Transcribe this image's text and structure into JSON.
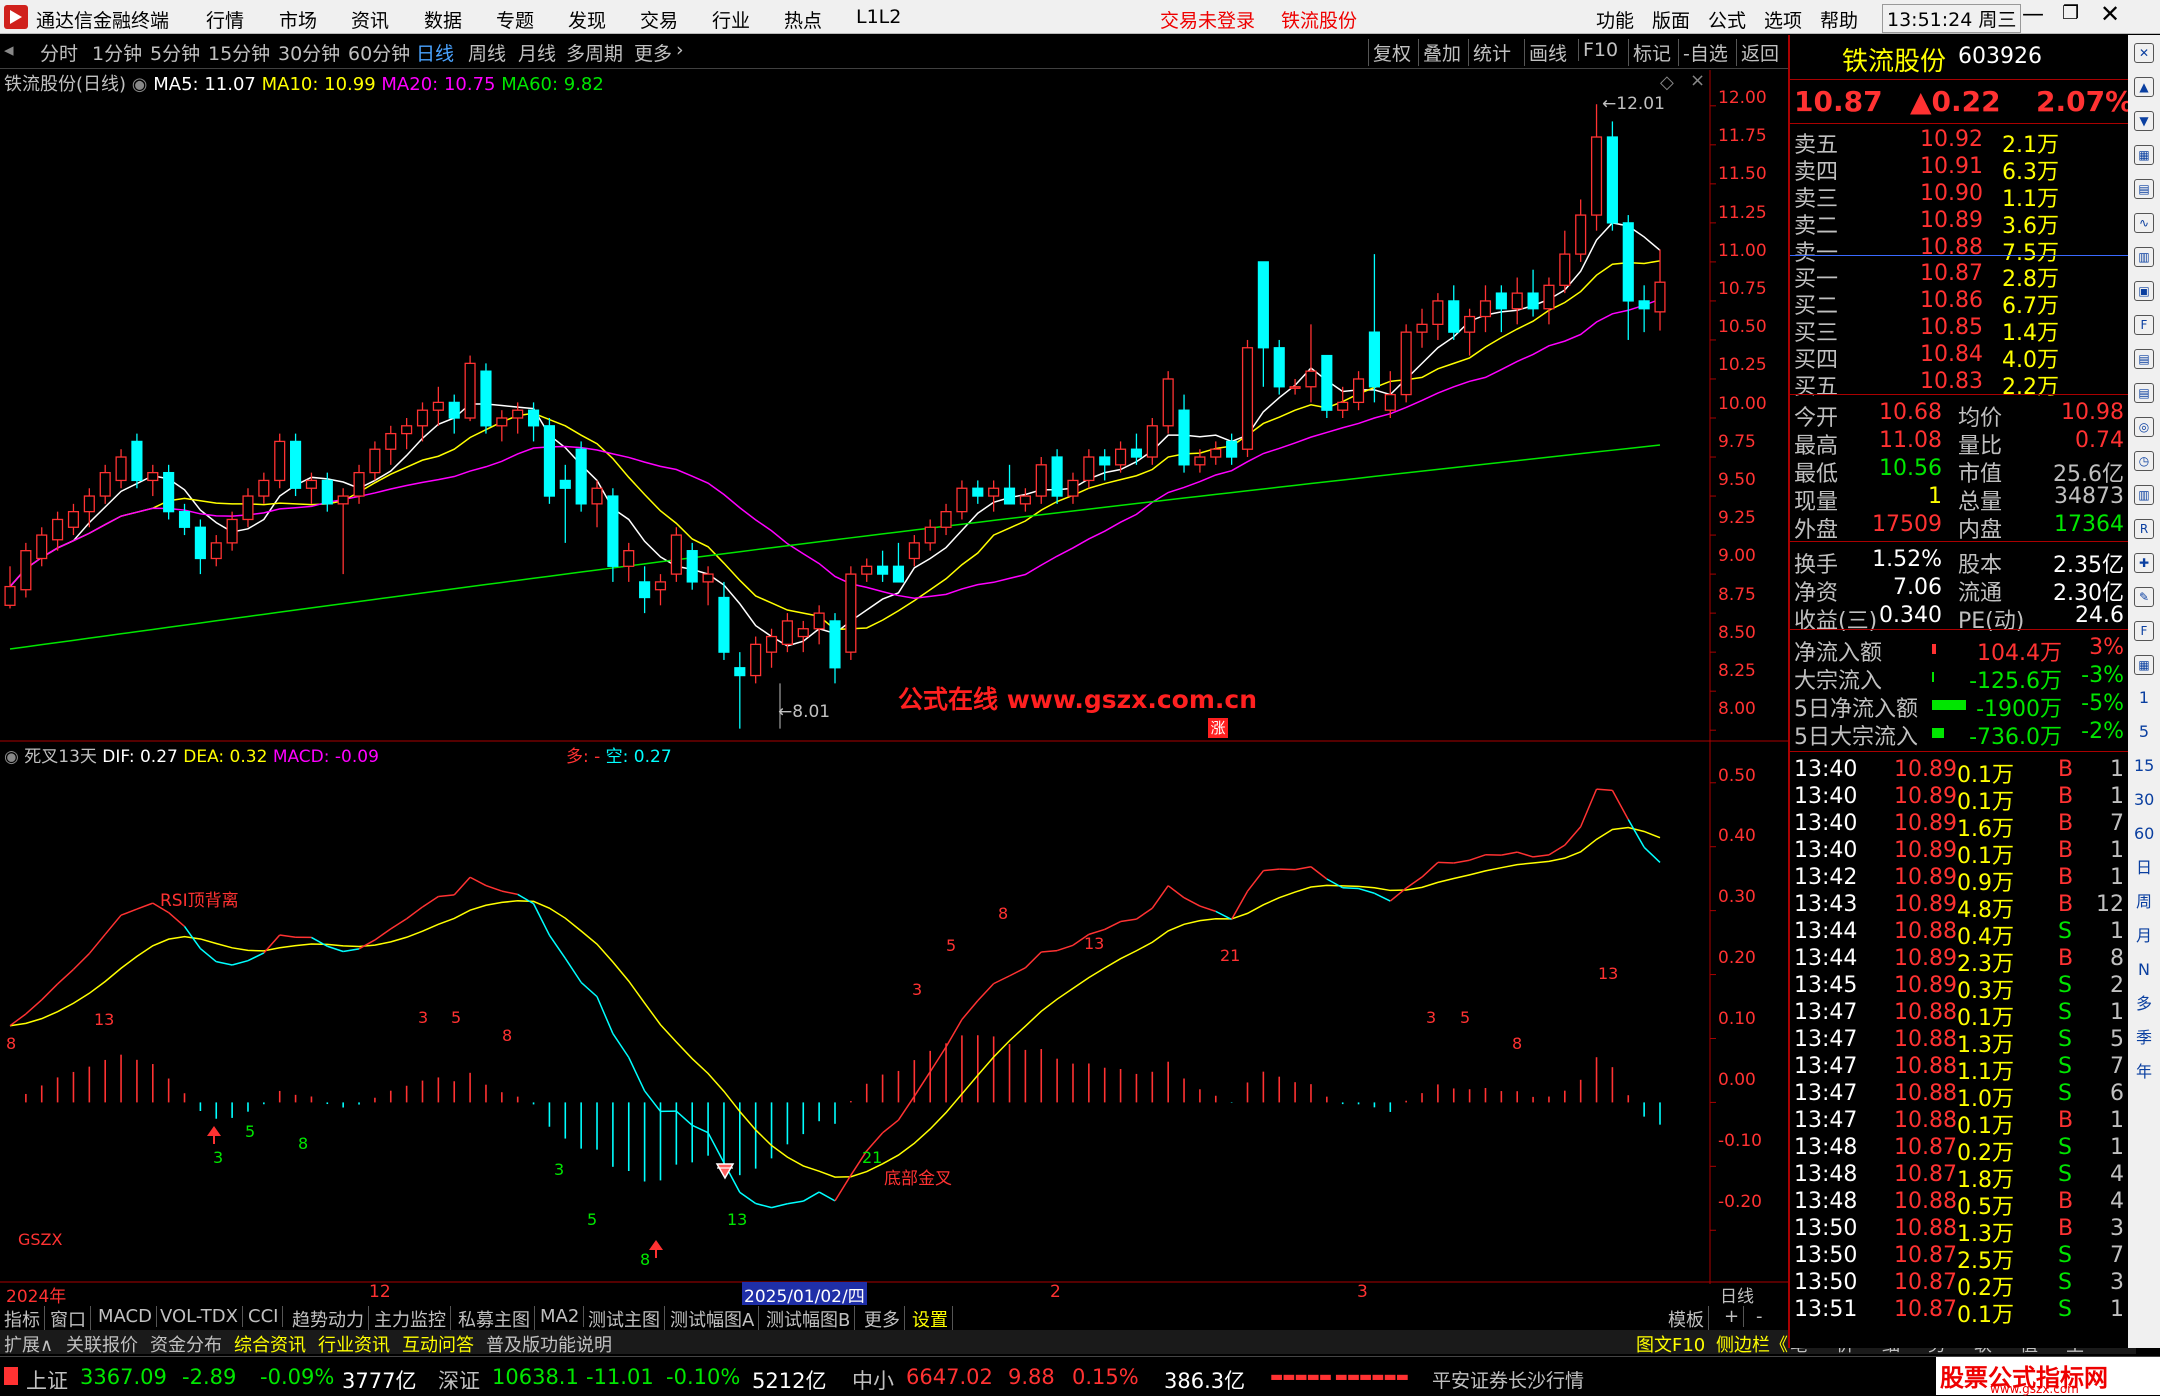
{
  "menubar": {
    "app_title": "通达信金融终端",
    "menus": [
      "行情",
      "市场",
      "资讯",
      "数据",
      "专题",
      "发现",
      "交易",
      "行业",
      "热点",
      "L1L2"
    ],
    "trade_status": "交易未登录",
    "stock_name": "铁流股份",
    "right_menus": [
      "功能",
      "版面",
      "公式",
      "选项",
      "帮助"
    ],
    "time": "13:51:24",
    "weekday": "周三"
  },
  "period_tabs": [
    "分时",
    "1分钟",
    "5分钟",
    "15分钟",
    "30分钟",
    "60分钟",
    "日线",
    "周线",
    "月线",
    "多周期",
    "更多"
  ],
  "active_period": "日线",
  "right_tools": [
    "复权",
    "叠加",
    "统计",
    "画线",
    "F10",
    "标记",
    "-自选",
    "返回"
  ],
  "kline_header": {
    "name": "铁流股份(日线)",
    "ma5": "MA5: 11.07",
    "ma10": "MA10: 10.99",
    "ma20": "MA20: 10.75",
    "ma60": "MA60: 9.82"
  },
  "price_axis": [
    "12.00",
    "11.75",
    "11.50",
    "11.25",
    "11.00",
    "10.75",
    "10.50",
    "10.25",
    "10.00",
    "9.75",
    "9.50",
    "9.25",
    "9.00",
    "8.75",
    "8.50",
    "8.25",
    "8.00"
  ],
  "high_marker": "12.01",
  "low_marker": "8.01",
  "watermark": "公式在线  www.gszx.com.cn",
  "zhang_badge": "涨",
  "indicator_header": {
    "name": "死叉13天",
    "dif": "DIF: 0.27",
    "dea": "DEA: 0.32",
    "macd": "MACD: -0.09",
    "duo": "多: -",
    "kong": "空: 0.27"
  },
  "macd_axis": [
    "0.50",
    "0.40",
    "0.30",
    "0.20",
    "0.10",
    "0.00",
    "-0.10",
    "-0.20"
  ],
  "annotations": {
    "rsi_div": "RSI顶背离",
    "bottom_cross": "底部金叉",
    "gszx": "GSZX"
  },
  "macd_counts": [
    {
      "t": "8",
      "c": "red"
    },
    {
      "t": "13",
      "c": "red"
    },
    {
      "t": "3",
      "c": "green"
    },
    {
      "t": "5",
      "c": "green"
    },
    {
      "t": "8",
      "c": "green"
    },
    {
      "t": "3",
      "c": "red"
    },
    {
      "t": "5",
      "c": "red"
    },
    {
      "t": "8",
      "c": "red"
    },
    {
      "t": "3",
      "c": "green"
    },
    {
      "t": "5",
      "c": "green"
    },
    {
      "t": "8",
      "c": "green"
    },
    {
      "t": "13",
      "c": "green"
    },
    {
      "t": "21",
      "c": "green"
    },
    {
      "t": "3",
      "c": "red"
    },
    {
      "t": "5",
      "c": "red"
    },
    {
      "t": "8",
      "c": "red"
    },
    {
      "t": "13",
      "c": "red"
    },
    {
      "t": "21",
      "c": "red"
    },
    {
      "t": "3",
      "c": "red"
    },
    {
      "t": "5",
      "c": "red"
    },
    {
      "t": "8",
      "c": "red"
    },
    {
      "t": "13",
      "c": "red"
    }
  ],
  "time_axis": {
    "year": "2024年",
    "m12": "12",
    "date": "2025/01/02/四",
    "m2": "2",
    "m3": "3",
    "period": "日线"
  },
  "bottom_tabs1": [
    "指标",
    "窗口",
    "MACD",
    "VOL-TDX",
    "CCI",
    "趋势动力",
    "主力监控",
    "私募主图",
    "MA2",
    "测试主图",
    "测试幅图A",
    "测试幅图B",
    "更多",
    "设置"
  ],
  "bottom_tabs1_right": [
    "模板",
    "+",
    "-"
  ],
  "bottom_tabs2": [
    "扩展∧",
    "关联报价",
    "资金分布",
    "综合资讯",
    "行业资讯",
    "互动问答",
    "普及版功能说明"
  ],
  "bottom_tabs2_right": [
    "图文F10",
    "侧边栏《",
    "笔",
    "价",
    "细",
    "势",
    "联",
    "值",
    "主"
  ],
  "quote": {
    "name": "铁流股份",
    "code": "603926",
    "price": "10.87",
    "change": "▲0.22",
    "pct": "2.07%",
    "asks": [
      [
        "卖五",
        "10.92",
        "2.1万"
      ],
      [
        "卖四",
        "10.91",
        "6.3万"
      ],
      [
        "卖三",
        "10.90",
        "1.1万"
      ],
      [
        "卖二",
        "10.89",
        "3.6万"
      ],
      [
        "卖一",
        "10.88",
        "7.5万"
      ]
    ],
    "bids": [
      [
        "买一",
        "10.87",
        "2.8万"
      ],
      [
        "买二",
        "10.86",
        "6.7万"
      ],
      [
        "买三",
        "10.85",
        "1.4万"
      ],
      [
        "买四",
        "10.84",
        "4.0万"
      ],
      [
        "买五",
        "10.83",
        "2.2万"
      ]
    ],
    "stats": [
      [
        "今开",
        "10.68",
        "均价",
        "10.98"
      ],
      [
        "最高",
        "11.08",
        "量比",
        "0.74"
      ],
      [
        "最低",
        "10.56",
        "市值",
        "25.6亿"
      ],
      [
        "现量",
        "1",
        "总量",
        "34873"
      ],
      [
        "外盘",
        "17509",
        "内盘",
        "17364"
      ]
    ],
    "stats2": [
      [
        "换手",
        "1.52%",
        "股本",
        "2.35亿"
      ],
      [
        "净资",
        "7.06",
        "流通",
        "2.30亿"
      ],
      [
        "收益(三)",
        "0.340",
        "PE(动)",
        "24.6"
      ]
    ],
    "flows": [
      [
        "净流入额",
        "104.4万",
        "3%"
      ],
      [
        "大宗流入",
        "-125.6万",
        "-3%"
      ],
      [
        "5日净流入额",
        "-1900万",
        "-5%"
      ],
      [
        "5日大宗流入",
        "-736.0万",
        "-2%"
      ]
    ],
    "ticks": [
      [
        "13:40",
        "10.89",
        "0.1万",
        "B",
        "1"
      ],
      [
        "13:40",
        "10.89",
        "0.1万",
        "B",
        "1"
      ],
      [
        "13:40",
        "10.89",
        "1.6万",
        "B",
        "7"
      ],
      [
        "13:40",
        "10.89",
        "0.1万",
        "B",
        "1"
      ],
      [
        "13:42",
        "10.89",
        "0.9万",
        "B",
        "1"
      ],
      [
        "13:43",
        "10.89",
        "4.8万",
        "B",
        "12"
      ],
      [
        "13:44",
        "10.88",
        "0.4万",
        "S",
        "1"
      ],
      [
        "13:44",
        "10.89",
        "2.3万",
        "B",
        "8"
      ],
      [
        "13:45",
        "10.89",
        "0.3万",
        "S",
        "2"
      ],
      [
        "13:47",
        "10.88",
        "0.1万",
        "S",
        "1"
      ],
      [
        "13:47",
        "10.88",
        "1.3万",
        "S",
        "5"
      ],
      [
        "13:47",
        "10.88",
        "1.1万",
        "S",
        "7"
      ],
      [
        "13:47",
        "10.88",
        "1.0万",
        "S",
        "6"
      ],
      [
        "13:47",
        "10.88",
        "0.1万",
        "B",
        "1"
      ],
      [
        "13:48",
        "10.87",
        "0.2万",
        "S",
        "1"
      ],
      [
        "13:48",
        "10.87",
        "1.8万",
        "S",
        "4"
      ],
      [
        "13:48",
        "10.88",
        "0.5万",
        "B",
        "4"
      ],
      [
        "13:50",
        "10.88",
        "1.3万",
        "B",
        "3"
      ],
      [
        "13:50",
        "10.87",
        "2.5万",
        "S",
        "7"
      ],
      [
        "13:50",
        "10.87",
        "0.2万",
        "S",
        "3"
      ],
      [
        "13:51",
        "10.87",
        "0.1万",
        "S",
        "1"
      ]
    ]
  },
  "sidebar_icons": [
    "up-arrow",
    "down-arrow",
    "chart",
    "grid",
    "chart-2",
    "candles",
    "news",
    "f10",
    "doc",
    "doc-2",
    "ring",
    "clock",
    "bars",
    "rsi",
    "plus",
    "pen",
    "f5",
    "doc-3"
  ],
  "sidebar_labels": [
    "1",
    "5",
    "15",
    "30",
    "60",
    "日",
    "周",
    "月",
    "N",
    "多",
    "季",
    "年"
  ],
  "status": {
    "sh_name": "上证",
    "sh_val": "3367.09",
    "sh_chg": "-2.89",
    "sh_pct": "-0.09%",
    "sh_amt": "3777亿",
    "sz_name": "深证",
    "sz_val": "10638.1",
    "sz_chg": "-11.01",
    "sz_pct": "-0.10%",
    "sz_amt": "5212亿",
    "zx_name": "中小",
    "zx_val": "6647.02",
    "zx_chg": "9.88",
    "zx_pct": "0.15%",
    "zx_amt": "386.3亿",
    "broker": "平安证券长沙行情",
    "logo_text": "股票公式指标网",
    "logo_url": "www.gszx.com"
  },
  "chart_data": {
    "type": "candlestick",
    "ohlc": [
      [
        8.8,
        9.05,
        8.78,
        8.92
      ],
      [
        8.9,
        9.2,
        8.85,
        9.15
      ],
      [
        9.1,
        9.3,
        9.05,
        9.25
      ],
      [
        9.22,
        9.4,
        9.15,
        9.35
      ],
      [
        9.3,
        9.45,
        9.25,
        9.4
      ],
      [
        9.4,
        9.55,
        9.3,
        9.5
      ],
      [
        9.5,
        9.7,
        9.45,
        9.65
      ],
      [
        9.6,
        9.8,
        9.55,
        9.75
      ],
      [
        9.85,
        9.9,
        9.55,
        9.6
      ],
      [
        9.6,
        9.7,
        9.5,
        9.65
      ],
      [
        9.65,
        9.7,
        9.35,
        9.4
      ],
      [
        9.4,
        9.45,
        9.25,
        9.3
      ],
      [
        9.3,
        9.35,
        9.0,
        9.1
      ],
      [
        9.1,
        9.25,
        9.05,
        9.2
      ],
      [
        9.2,
        9.4,
        9.15,
        9.35
      ],
      [
        9.35,
        9.55,
        9.3,
        9.5
      ],
      [
        9.5,
        9.65,
        9.45,
        9.6
      ],
      [
        9.6,
        9.9,
        9.55,
        9.85
      ],
      [
        9.85,
        9.9,
        9.5,
        9.55
      ],
      [
        9.55,
        9.65,
        9.45,
        9.6
      ],
      [
        9.6,
        9.65,
        9.4,
        9.45
      ],
      [
        9.45,
        9.55,
        9.0,
        9.5
      ],
      [
        9.5,
        9.7,
        9.45,
        9.65
      ],
      [
        9.65,
        9.85,
        9.6,
        9.8
      ],
      [
        9.8,
        9.95,
        9.7,
        9.9
      ],
      [
        9.9,
        10.0,
        9.8,
        9.95
      ],
      [
        9.95,
        10.1,
        9.85,
        10.05
      ],
      [
        10.05,
        10.2,
        9.95,
        10.1
      ],
      [
        10.1,
        10.15,
        9.9,
        10.0
      ],
      [
        10.0,
        10.4,
        9.98,
        10.35
      ],
      [
        10.3,
        10.35,
        9.9,
        9.95
      ],
      [
        9.95,
        10.05,
        9.85,
        10.0
      ],
      [
        10.0,
        10.1,
        9.9,
        10.05
      ],
      [
        10.05,
        10.1,
        9.85,
        9.95
      ],
      [
        9.95,
        10.0,
        9.45,
        9.5
      ],
      [
        9.6,
        9.7,
        9.2,
        9.55
      ],
      [
        9.8,
        9.85,
        9.4,
        9.45
      ],
      [
        9.45,
        9.6,
        9.3,
        9.55
      ],
      [
        9.5,
        9.55,
        8.95,
        9.05
      ],
      [
        9.05,
        9.2,
        8.95,
        9.15
      ],
      [
        8.95,
        9.05,
        8.75,
        8.85
      ],
      [
        8.9,
        9.0,
        8.8,
        8.95
      ],
      [
        9.0,
        9.3,
        8.95,
        9.25
      ],
      [
        9.15,
        9.2,
        8.9,
        8.95
      ],
      [
        8.95,
        9.05,
        8.8,
        9.0
      ],
      [
        8.85,
        8.95,
        8.45,
        8.5
      ],
      [
        8.4,
        8.5,
        8.01,
        8.35
      ],
      [
        8.35,
        8.6,
        8.3,
        8.55
      ],
      [
        8.5,
        8.65,
        8.4,
        8.6
      ],
      [
        8.55,
        8.75,
        8.5,
        8.7
      ],
      [
        8.6,
        8.7,
        8.5,
        8.65
      ],
      [
        8.65,
        8.8,
        8.55,
        8.75
      ],
      [
        8.7,
        8.75,
        8.3,
        8.4
      ],
      [
        8.5,
        9.05,
        8.45,
        9.0
      ],
      [
        9.0,
        9.1,
        8.95,
        9.05
      ],
      [
        9.05,
        9.15,
        8.95,
        9.0
      ],
      [
        9.05,
        9.2,
        9.0,
        8.95
      ],
      [
        9.1,
        9.25,
        9.05,
        9.2
      ],
      [
        9.2,
        9.35,
        9.15,
        9.3
      ],
      [
        9.3,
        9.45,
        9.25,
        9.4
      ],
      [
        9.4,
        9.6,
        9.35,
        9.55
      ],
      [
        9.55,
        9.6,
        9.45,
        9.5
      ],
      [
        9.5,
        9.6,
        9.4,
        9.55
      ],
      [
        9.55,
        9.7,
        9.45,
        9.45
      ],
      [
        9.45,
        9.55,
        9.4,
        9.5
      ],
      [
        9.5,
        9.75,
        9.45,
        9.7
      ],
      [
        9.75,
        9.8,
        9.45,
        9.5
      ],
      [
        9.5,
        9.65,
        9.45,
        9.6
      ],
      [
        9.6,
        9.8,
        9.55,
        9.75
      ],
      [
        9.75,
        9.8,
        9.6,
        9.7
      ],
      [
        9.7,
        9.85,
        9.65,
        9.8
      ],
      [
        9.8,
        9.9,
        9.7,
        9.75
      ],
      [
        9.75,
        10.0,
        9.7,
        9.95
      ],
      [
        9.95,
        10.3,
        9.9,
        10.25
      ],
      [
        10.05,
        10.15,
        9.65,
        9.7
      ],
      [
        9.7,
        9.8,
        9.65,
        9.75
      ],
      [
        9.75,
        9.85,
        9.7,
        9.8
      ],
      [
        9.85,
        9.9,
        9.7,
        9.75
      ],
      [
        9.8,
        10.5,
        9.75,
        10.45
      ],
      [
        11.0,
        11.0,
        10.2,
        10.45
      ],
      [
        10.45,
        10.5,
        10.15,
        10.2
      ],
      [
        10.2,
        10.25,
        10.15,
        10.2
      ],
      [
        10.2,
        10.6,
        10.1,
        10.3
      ],
      [
        10.4,
        10.4,
        10.0,
        10.05
      ],
      [
        10.05,
        10.2,
        10.0,
        10.1
      ],
      [
        10.1,
        10.3,
        10.05,
        10.25
      ],
      [
        10.55,
        11.05,
        10.1,
        10.2
      ],
      [
        10.05,
        10.3,
        10.0,
        10.15
      ],
      [
        10.15,
        10.6,
        10.1,
        10.55
      ],
      [
        10.55,
        10.7,
        10.45,
        10.6
      ],
      [
        10.6,
        10.8,
        10.5,
        10.75
      ],
      [
        10.75,
        10.85,
        10.5,
        10.55
      ],
      [
        10.55,
        10.7,
        10.4,
        10.65
      ],
      [
        10.65,
        10.85,
        10.55,
        10.75
      ],
      [
        10.8,
        10.85,
        10.55,
        10.7
      ],
      [
        10.7,
        10.9,
        10.6,
        10.8
      ],
      [
        10.8,
        10.95,
        10.65,
        10.7
      ],
      [
        10.7,
        10.9,
        10.6,
        10.85
      ],
      [
        10.85,
        11.2,
        10.8,
        11.05
      ],
      [
        11.05,
        11.4,
        11.0,
        11.3
      ],
      [
        11.3,
        12.01,
        11.2,
        11.8
      ],
      [
        11.8,
        11.9,
        11.2,
        11.25
      ],
      [
        11.25,
        11.3,
        10.5,
        10.75
      ],
      [
        10.75,
        10.85,
        10.55,
        10.7
      ],
      [
        10.68,
        11.08,
        10.56,
        10.87
      ]
    ],
    "ma_series": [
      "MA5",
      "MA10",
      "MA20",
      "MA60"
    ],
    "ylim": [
      7.95,
      12.05
    ],
    "macd_ylim": [
      -0.27,
      0.52
    ]
  },
  "colors": {
    "up": "#ff3232",
    "down": "#00ffff",
    "ma5": "#ffffff",
    "ma10": "#ffff00",
    "ma20": "#ff00ff",
    "ma60": "#00e600",
    "accent": "#4aa3ff"
  }
}
